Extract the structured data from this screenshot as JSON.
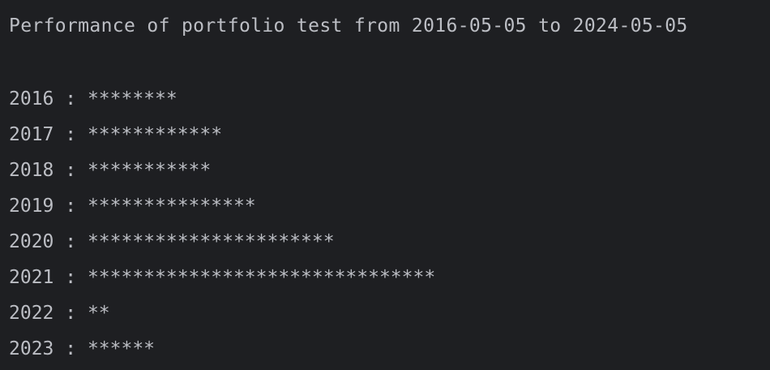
{
  "console": {
    "title": "Performance of portfolio test from 2016-05-05 to 2024-05-05",
    "separator": " : ",
    "rows": [
      {
        "year": "2016",
        "bar": "********"
      },
      {
        "year": "2017",
        "bar": "************"
      },
      {
        "year": "2018",
        "bar": "***********"
      },
      {
        "year": "2019",
        "bar": "***************"
      },
      {
        "year": "2020",
        "bar": "**********************"
      },
      {
        "year": "2021",
        "bar": "*******************************"
      },
      {
        "year": "2022",
        "bar": "**"
      },
      {
        "year": "2023",
        "bar": "******"
      }
    ]
  }
}
